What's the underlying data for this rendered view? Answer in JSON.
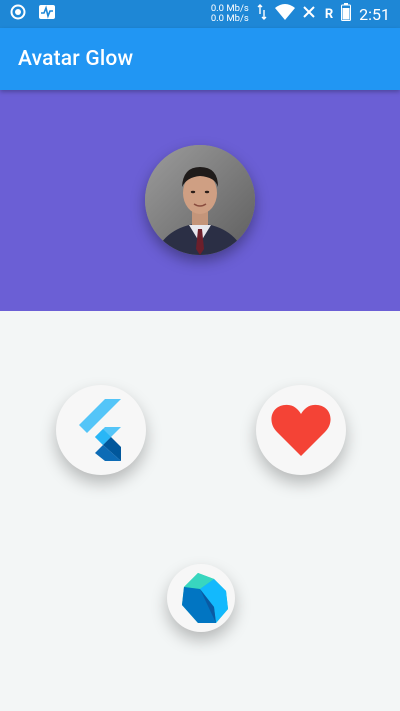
{
  "status_bar": {
    "net_speed_up": "0.0 Mb/s",
    "net_speed_down": "0.0 Mb/s",
    "roaming": "R",
    "time": "2:51"
  },
  "app_bar": {
    "title": "Avatar Glow"
  },
  "colors": {
    "status_bar": "#1e87d6",
    "app_bar": "#2196f3",
    "header_panel": "#6b5fd5",
    "background": "#f3f6f6",
    "heart": "#f44336"
  },
  "icons": [
    "record-icon",
    "activity-icon",
    "data-arrows-icon",
    "wifi-icon",
    "no-signal-icon",
    "battery-icon",
    "flutter-logo-icon",
    "heart-icon",
    "dart-logo-icon"
  ]
}
